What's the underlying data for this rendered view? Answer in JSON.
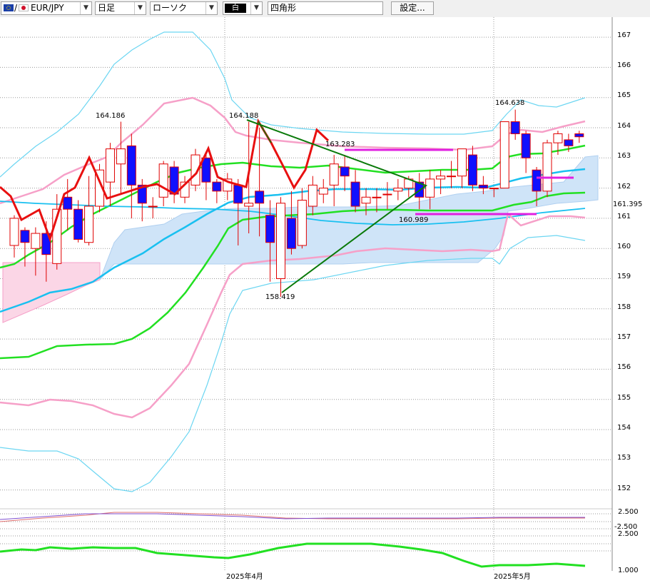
{
  "toolbar": {
    "symbol_separator": "/",
    "symbol": "EUR/JPY",
    "timeframe": "日足",
    "chart_style": "ローソク",
    "color_swatch": "白",
    "shape_tool": "四角形",
    "settings_button": "設定..."
  },
  "colors": {
    "bullish_candle": "#ffffff",
    "bearish_candle": "#1010ff",
    "candle_outline": "#e00000",
    "price_line": "#e81010",
    "bollinger_inner": "#f6a0c8",
    "bollinger_outer": "#6cd6f2",
    "moving_average_green": "#22e022",
    "moving_average_blue": "#19c0f0",
    "cloud_fill": "#cfe4f8",
    "cloud_fill_bearish": "#fbd6e6",
    "trendline": "#0a7a0a",
    "horizontal_marker": "#e020e0"
  },
  "chart_data": {
    "type": "candlestick",
    "y_axis": {
      "ticks": [
        "167",
        "166",
        "165",
        "164",
        "163",
        "162",
        "161",
        "160",
        "159",
        "158",
        "157",
        "156",
        "155",
        "154",
        "153",
        "152"
      ],
      "current_price_label": "161.395"
    },
    "x_axis": {
      "labels": [
        "2025年4月",
        "2025年5月"
      ]
    },
    "price_annotations": [
      "164.186",
      "164.188",
      "163.283",
      "160.989",
      "158.419",
      "164.638"
    ],
    "candles": [
      [
        160.1,
        161.0,
        159.7,
        161.1
      ],
      [
        160.6,
        160.2,
        159.4,
        160.7
      ],
      [
        160.0,
        160.5,
        159.1,
        160.7
      ],
      [
        160.5,
        159.8,
        158.9,
        160.9
      ],
      [
        159.5,
        161.3,
        159.3,
        161.8
      ],
      [
        161.7,
        161.3,
        160.6,
        162.3
      ],
      [
        161.3,
        160.3,
        160.2,
        161.6
      ],
      [
        160.2,
        161.4,
        160.1,
        162.4
      ],
      [
        161.4,
        162.6,
        161.2,
        162.8
      ],
      [
        162.2,
        163.3,
        161.4,
        163.5
      ],
      [
        162.8,
        163.3,
        161.8,
        164.2
      ],
      [
        163.4,
        162.1,
        161.0,
        163.8
      ],
      [
        162.1,
        161.5,
        160.9,
        162.3
      ],
      [
        161.4,
        161.4,
        161.0,
        161.7
      ],
      [
        161.7,
        162.8,
        161.4,
        162.9
      ],
      [
        162.7,
        161.8,
        161.5,
        162.9
      ],
      [
        161.7,
        162.2,
        161.5,
        162.4
      ],
      [
        162.1,
        163.1,
        161.9,
        163.3
      ],
      [
        163.0,
        162.2,
        161.6,
        163.2
      ],
      [
        162.2,
        161.9,
        161.5,
        162.3
      ],
      [
        161.9,
        162.3,
        161.6,
        162.5
      ],
      [
        162.1,
        161.5,
        160.1,
        162.3
      ],
      [
        161.4,
        161.5,
        160.5,
        164.2
      ],
      [
        161.9,
        161.5,
        160.4,
        164.0
      ],
      [
        161.1,
        160.2,
        158.9,
        161.6
      ],
      [
        159.0,
        161.5,
        158.4,
        161.7
      ],
      [
        161.0,
        160.0,
        159.8,
        161.9
      ],
      [
        160.1,
        161.6,
        160.0,
        162.0
      ],
      [
        161.4,
        162.1,
        161.1,
        162.4
      ],
      [
        161.8,
        162.0,
        161.5,
        162.3
      ],
      [
        162.1,
        162.8,
        161.4,
        163.1
      ],
      [
        162.7,
        162.4,
        161.9,
        163.1
      ],
      [
        162.2,
        161.4,
        161.2,
        162.6
      ],
      [
        161.5,
        161.7,
        161.1,
        162.0
      ],
      [
        161.7,
        161.7,
        161.2,
        162.0
      ],
      [
        161.8,
        161.8,
        161.3,
        162.2
      ],
      [
        161.9,
        162.0,
        161.6,
        162.3
      ],
      [
        162.0,
        162.3,
        161.7,
        162.4
      ],
      [
        162.2,
        161.7,
        161.3,
        162.5
      ],
      [
        161.7,
        162.3,
        161.3,
        162.6
      ],
      [
        162.3,
        162.4,
        161.8,
        162.6
      ],
      [
        162.4,
        162.4,
        162.0,
        162.9
      ],
      [
        162.4,
        163.3,
        162.0,
        163.3
      ],
      [
        163.1,
        162.1,
        161.9,
        163.4
      ],
      [
        162.1,
        162.0,
        161.8,
        162.4
      ],
      [
        162.0,
        162.0,
        161.7,
        162.0
      ],
      [
        162.0,
        164.2,
        162.0,
        164.2
      ],
      [
        164.2,
        163.8,
        163.6,
        164.6
      ],
      [
        163.8,
        163.0,
        162.5,
        163.9
      ],
      [
        162.6,
        161.9,
        161.4,
        162.7
      ],
      [
        161.9,
        163.5,
        161.7,
        163.6
      ],
      [
        163.5,
        163.8,
        163.1,
        163.9
      ],
      [
        163.6,
        163.4,
        163.2,
        163.8
      ],
      [
        163.8,
        163.7,
        163.5,
        163.9
      ]
    ]
  },
  "indicator_labels": [
    "2.500",
    "-2.500",
    "2.500",
    "1.000"
  ]
}
